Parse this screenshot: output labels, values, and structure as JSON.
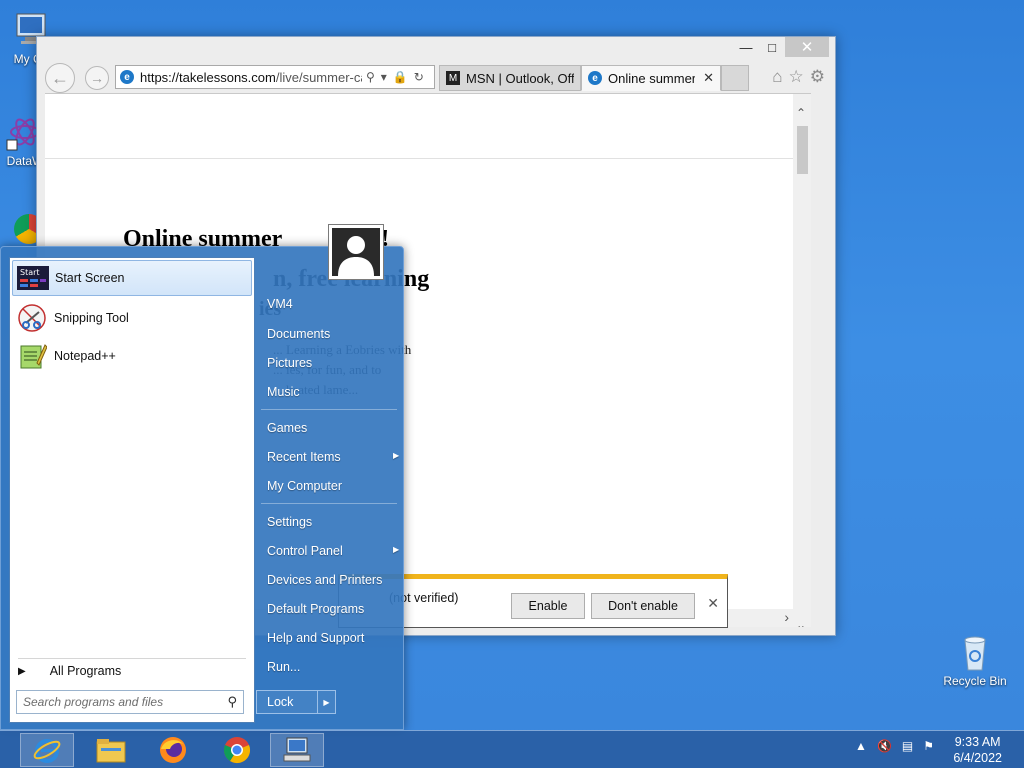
{
  "desktop": {
    "icons": [
      {
        "label": "My Co",
        "icon": "computer-icon"
      },
      {
        "label": "DataW",
        "icon": "datawrapper-icon"
      },
      {
        "label": "Recycle Bin",
        "icon": "recycle-bin-icon"
      }
    ]
  },
  "browser": {
    "url_host": "https://takelessons.com",
    "url_path": "/live/summer-car",
    "tabs": [
      {
        "label": "MSN | Outlook, Offi...",
        "state": "inactive"
      },
      {
        "label": "Online summer ...",
        "state": "active"
      }
    ],
    "page": {
      "title_left": "Online summer",
      "title_right": "p!",
      "subtitle_a": "n, free learning",
      "subtitle_b": "ies",
      "body_lines": [
        "... Learning a Eobries with",
        "... ies, for fun, and to",
        "... heated lame..."
      ]
    },
    "notification": {
      "text": "(not verified)",
      "enable_label": "Enable",
      "dont_enable_label": "Don't enable"
    }
  },
  "start_menu": {
    "pinned": [
      {
        "label": "Start Screen",
        "icon": "start-screen-icon",
        "selected": true
      },
      {
        "label": "Snipping Tool",
        "icon": "scissors-icon"
      },
      {
        "label": "Notepad++",
        "icon": "notepadpp-icon"
      }
    ],
    "all_programs": "All Programs",
    "search_placeholder": "Search programs and files",
    "right_links": {
      "user": "VM4",
      "documents": "Documents",
      "pictures": "Pictures",
      "music": "Music",
      "games": "Games",
      "recent_items": "Recent Items",
      "my_computer": "My Computer",
      "settings": "Settings",
      "control_panel": "Control Panel",
      "devices_printers": "Devices and Printers",
      "default_programs": "Default Programs",
      "help_support": "Help and Support",
      "run": "Run..."
    },
    "lock_label": "Lock"
  },
  "taskbar": {
    "items": [
      "ie-icon",
      "file-explorer-icon",
      "firefox-icon",
      "chrome-icon",
      "network-computer-icon"
    ],
    "clock_time": "9:33 AM",
    "clock_date": "6/4/2022"
  },
  "colors": {
    "desktop": "#3a86dc",
    "start_menu": "#3476be",
    "notify_accent": "#f0b41c"
  }
}
